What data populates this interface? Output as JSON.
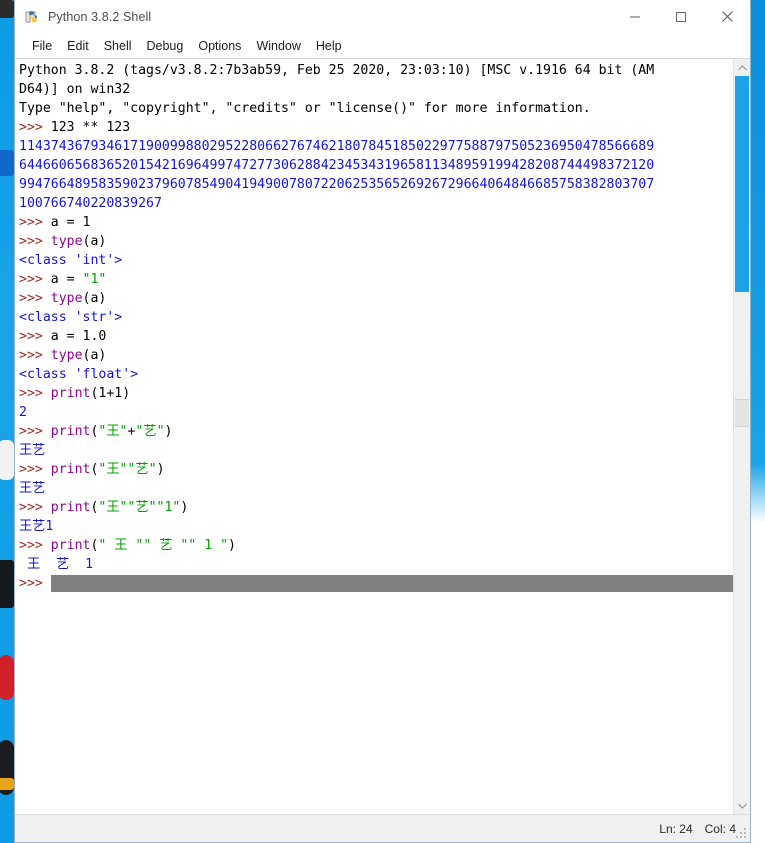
{
  "window": {
    "title": "Python 3.8.2 Shell",
    "icon": "python-idle-icon",
    "controls": {
      "minimize": "minimize-icon",
      "maximize": "maximize-icon",
      "close": "close-icon"
    }
  },
  "menu": {
    "items": [
      "File",
      "Edit",
      "Shell",
      "Debug",
      "Options",
      "Window",
      "Help"
    ]
  },
  "shell": {
    "lines": [
      {
        "segments": [
          {
            "text": "Python 3.8.2 (tags/v3.8.2:7b3ab59, Feb 25 2020, 23:03:10) [MSC v.1916 64 bit (AM",
            "style": "black"
          }
        ]
      },
      {
        "segments": [
          {
            "text": "D64)] on win32",
            "style": "black"
          }
        ]
      },
      {
        "segments": [
          {
            "text": "Type \"help\", \"copyright\", \"credits\" or \"license()\" for more information.",
            "style": "black"
          }
        ]
      },
      {
        "segments": [
          {
            "text": ">>> ",
            "style": "prompt"
          },
          {
            "text": "123 ** 123",
            "style": "black"
          }
        ]
      },
      {
        "segments": [
          {
            "text": "11437436793461719009988029522806627674621807845185022977588797505236950478566689",
            "style": "blue"
          }
        ]
      },
      {
        "segments": [
          {
            "text": "64466065683652015421696499747277306288423453431965811348959199428208744498372120",
            "style": "blue"
          }
        ]
      },
      {
        "segments": [
          {
            "text": "99476648958359023796078549041949007807220625356526926729664064846685758382803707",
            "style": "blue"
          }
        ]
      },
      {
        "segments": [
          {
            "text": "100766740220839267",
            "style": "blue"
          }
        ]
      },
      {
        "segments": [
          {
            "text": ">>> ",
            "style": "prompt"
          },
          {
            "text": "a = 1",
            "style": "black"
          }
        ]
      },
      {
        "segments": [
          {
            "text": ">>> ",
            "style": "prompt"
          },
          {
            "text": "type",
            "style": "purple"
          },
          {
            "text": "(a)",
            "style": "black"
          }
        ]
      },
      {
        "segments": [
          {
            "text": "<class 'int'>",
            "style": "blue"
          }
        ]
      },
      {
        "segments": [
          {
            "text": ">>> ",
            "style": "prompt"
          },
          {
            "text": "a = ",
            "style": "black"
          },
          {
            "text": "\"1\"",
            "style": "green"
          }
        ]
      },
      {
        "segments": [
          {
            "text": ">>> ",
            "style": "prompt"
          },
          {
            "text": "type",
            "style": "purple"
          },
          {
            "text": "(a)",
            "style": "black"
          }
        ]
      },
      {
        "segments": [
          {
            "text": "<class 'str'>",
            "style": "blue"
          }
        ]
      },
      {
        "segments": [
          {
            "text": ">>> ",
            "style": "prompt"
          },
          {
            "text": "a = 1.0",
            "style": "black"
          }
        ]
      },
      {
        "segments": [
          {
            "text": ">>> ",
            "style": "prompt"
          },
          {
            "text": "type",
            "style": "purple"
          },
          {
            "text": "(a)",
            "style": "black"
          }
        ]
      },
      {
        "segments": [
          {
            "text": "<class 'float'>",
            "style": "blue"
          }
        ]
      },
      {
        "segments": [
          {
            "text": ">>> ",
            "style": "prompt"
          },
          {
            "text": "print",
            "style": "purple"
          },
          {
            "text": "(1+1)",
            "style": "black"
          }
        ]
      },
      {
        "segments": [
          {
            "text": "2",
            "style": "blue"
          }
        ]
      },
      {
        "segments": [
          {
            "text": ">>> ",
            "style": "prompt"
          },
          {
            "text": "print",
            "style": "purple"
          },
          {
            "text": "(",
            "style": "black"
          },
          {
            "text": "\"王\"",
            "style": "green"
          },
          {
            "text": "+",
            "style": "black"
          },
          {
            "text": "\"艺\"",
            "style": "green"
          },
          {
            "text": ")",
            "style": "black"
          }
        ]
      },
      {
        "segments": [
          {
            "text": "王艺",
            "style": "blue"
          }
        ]
      },
      {
        "segments": [
          {
            "text": ">>> ",
            "style": "prompt"
          },
          {
            "text": "print",
            "style": "purple"
          },
          {
            "text": "(",
            "style": "black"
          },
          {
            "text": "\"王\"\"艺\"",
            "style": "green"
          },
          {
            "text": ")",
            "style": "black"
          }
        ]
      },
      {
        "segments": [
          {
            "text": "王艺",
            "style": "blue"
          }
        ]
      },
      {
        "segments": [
          {
            "text": ">>> ",
            "style": "prompt"
          },
          {
            "text": "print",
            "style": "purple"
          },
          {
            "text": "(",
            "style": "black"
          },
          {
            "text": "\"王\"\"艺\"\"1\"",
            "style": "green"
          },
          {
            "text": ")",
            "style": "black"
          }
        ]
      },
      {
        "segments": [
          {
            "text": "王艺1",
            "style": "blue"
          }
        ]
      },
      {
        "segments": [
          {
            "text": ">>> ",
            "style": "prompt"
          },
          {
            "text": "print",
            "style": "purple"
          },
          {
            "text": "(",
            "style": "black"
          },
          {
            "text": "\" 王 \"\" 艺 \"\" 1 \"",
            "style": "green"
          },
          {
            "text": ")",
            "style": "black"
          }
        ]
      },
      {
        "segments": [
          {
            "text": " 王  艺  1",
            "style": "blue"
          }
        ]
      },
      {
        "segments": [
          {
            "text": ">>> ",
            "style": "prompt"
          },
          {
            "text": "",
            "style": "selection"
          }
        ]
      }
    ],
    "selection_present": true
  },
  "status": {
    "line_label": "Ln: 24",
    "col_label": "Col: 4"
  },
  "colors": {
    "prompt": "#a3271f",
    "output": "#1414d4",
    "builtin": "#8f058f",
    "string": "#00a000",
    "selection": "#808080",
    "scrollbar_thumb": "#1aa3e8",
    "taskbar": "#1aa3e8"
  },
  "scrollbar": {
    "up_arrow": "chevron-up-icon",
    "down_arrow": "chevron-down-icon"
  }
}
